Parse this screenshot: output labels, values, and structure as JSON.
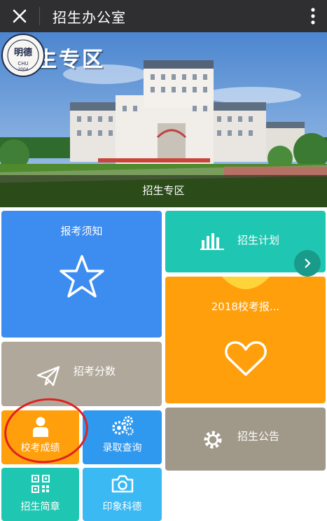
{
  "topbar": {
    "title": "招生办公室",
    "close_icon": "close-icon",
    "more_icon": "more-vertical-icon"
  },
  "banner": {
    "headline": "招生专区",
    "caption": "招生专区",
    "seal_text": "CHU 2004 明德"
  },
  "tiles": {
    "exam_notice": {
      "label": "报考须知",
      "icon": "star-icon"
    },
    "enroll_plan": {
      "label": "招生计划",
      "icon": "bar-chart-icon"
    },
    "exam_report": {
      "label": "2018校考报...",
      "icon": "heart-icon"
    },
    "score_line": {
      "label": "招考分数",
      "icon": "paper-plane-icon"
    },
    "exam_results": {
      "label": "校考成绩",
      "icon": "user-icon"
    },
    "admission_query": {
      "label": "录取查询",
      "icon": "gears-icon"
    },
    "announcement": {
      "label": "招生公告",
      "icon": "gear-icon"
    },
    "brochure": {
      "label": "招生简章",
      "icon": "qr-code-icon"
    },
    "impression": {
      "label": "印象科德",
      "icon": "camera-icon"
    }
  },
  "colors": {
    "topbar": "#2f2f31",
    "blue": "#3d8cf0",
    "teal": "#1fc7b2",
    "orange": "#ff9f0c",
    "gray": "#b0a99b",
    "annotation_circle": "#e02020"
  }
}
